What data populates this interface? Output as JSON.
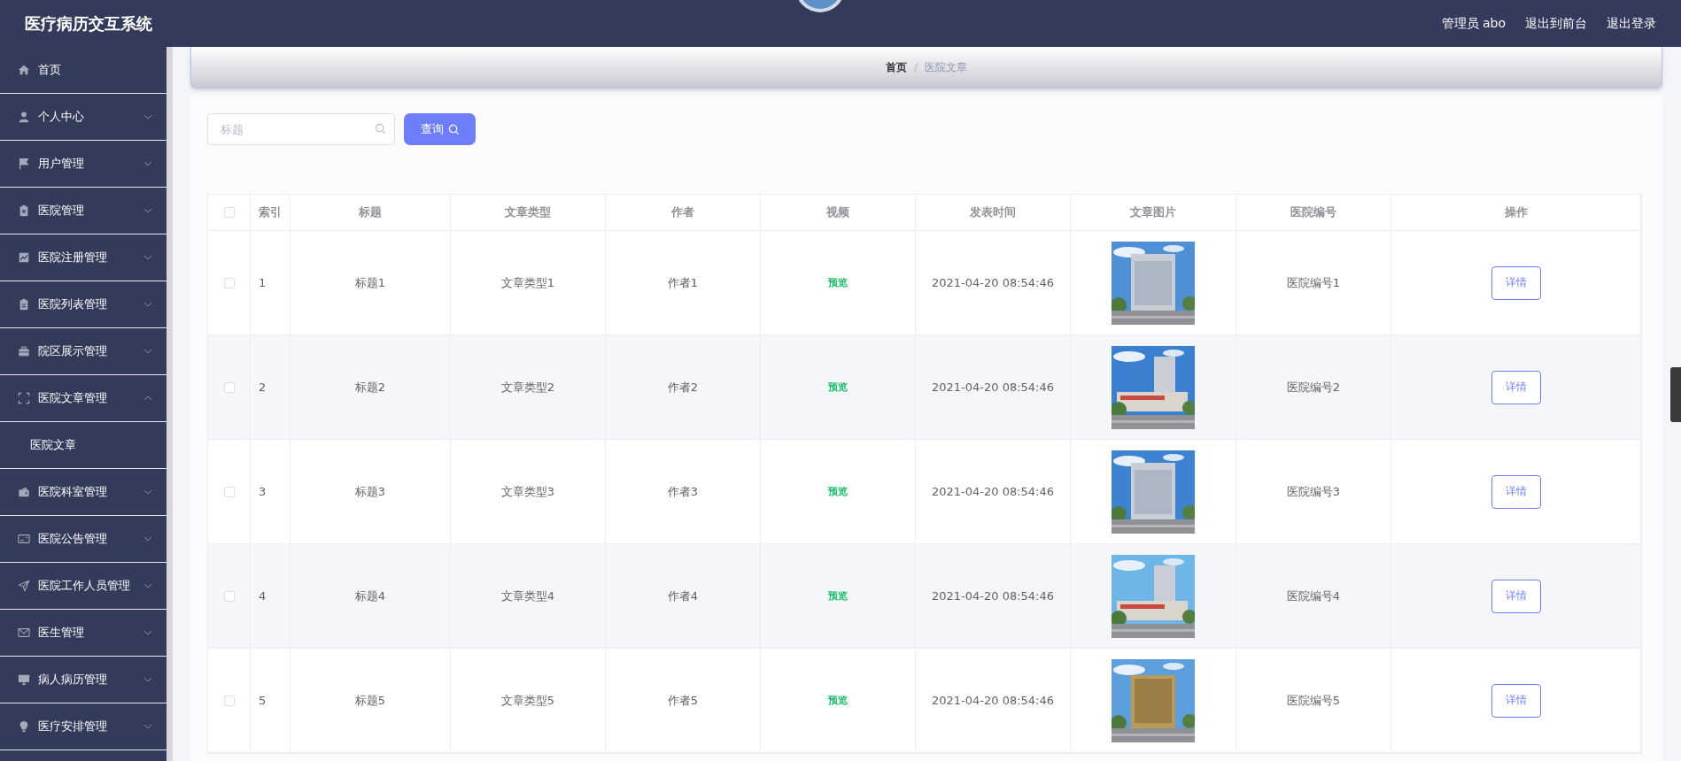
{
  "header": {
    "title": "医疗病历交互系统",
    "user": "管理员 abo",
    "links": [
      "退出到前台",
      "退出登录"
    ]
  },
  "sidebar": {
    "items": [
      {
        "label": "首页",
        "kind": "link"
      },
      {
        "label": "个人中心",
        "kind": "menu",
        "expanded": false
      },
      {
        "label": "用户管理",
        "kind": "menu",
        "expanded": false
      },
      {
        "label": "医院管理",
        "kind": "menu",
        "expanded": false
      },
      {
        "label": "医院注册管理",
        "kind": "menu",
        "expanded": false
      },
      {
        "label": "医院列表管理",
        "kind": "menu",
        "expanded": false
      },
      {
        "label": "院区展示管理",
        "kind": "menu",
        "expanded": false
      },
      {
        "label": "医院文章管理",
        "kind": "menu",
        "expanded": true,
        "children": [
          {
            "label": "医院文章"
          }
        ]
      },
      {
        "label": "医院科室管理",
        "kind": "menu",
        "expanded": false
      },
      {
        "label": "医院公告管理",
        "kind": "menu",
        "expanded": false
      },
      {
        "label": "医院工作人员管理",
        "kind": "menu",
        "expanded": false
      },
      {
        "label": "医生管理",
        "kind": "menu",
        "expanded": false
      },
      {
        "label": "病人病历管理",
        "kind": "menu",
        "expanded": false
      },
      {
        "label": "医疗安排管理",
        "kind": "menu",
        "expanded": false
      }
    ]
  },
  "breadcrumb": {
    "separator": "/",
    "items": [
      "首页",
      "医院文章"
    ]
  },
  "search": {
    "placeholder": "标题",
    "button": "查询"
  },
  "table": {
    "select_all": {
      "checked": false
    },
    "columns": [
      "索引",
      "标题",
      "文章类型",
      "作者",
      "视频",
      "发表时间",
      "文章图片",
      "医院编号",
      "操作"
    ],
    "rows": [
      {
        "checked": false,
        "index": "1",
        "title": "标题1",
        "type": "文章类型1",
        "author": "作者1",
        "video": "预览",
        "time": "2021-04-20 08:54:46",
        "hospital_no": "医院编号1",
        "action": "详情"
      },
      {
        "checked": false,
        "index": "2",
        "title": "标题2",
        "type": "文章类型2",
        "author": "作者2",
        "video": "预览",
        "time": "2021-04-20 08:54:46",
        "hospital_no": "医院编号2",
        "action": "详情"
      },
      {
        "checked": false,
        "index": "3",
        "title": "标题3",
        "type": "文章类型3",
        "author": "作者3",
        "video": "预览",
        "time": "2021-04-20 08:54:46",
        "hospital_no": "医院编号3",
        "action": "详情"
      },
      {
        "checked": false,
        "index": "4",
        "title": "标题4",
        "type": "文章类型4",
        "author": "作者4",
        "video": "预览",
        "time": "2021-04-20 08:54:46",
        "hospital_no": "医院编号4",
        "action": "详情"
      },
      {
        "checked": false,
        "index": "5",
        "title": "标题5",
        "type": "文章类型5",
        "author": "作者5",
        "video": "预览",
        "time": "2021-04-20 08:54:46",
        "hospital_no": "医院编号5",
        "action": "详情"
      }
    ]
  }
}
